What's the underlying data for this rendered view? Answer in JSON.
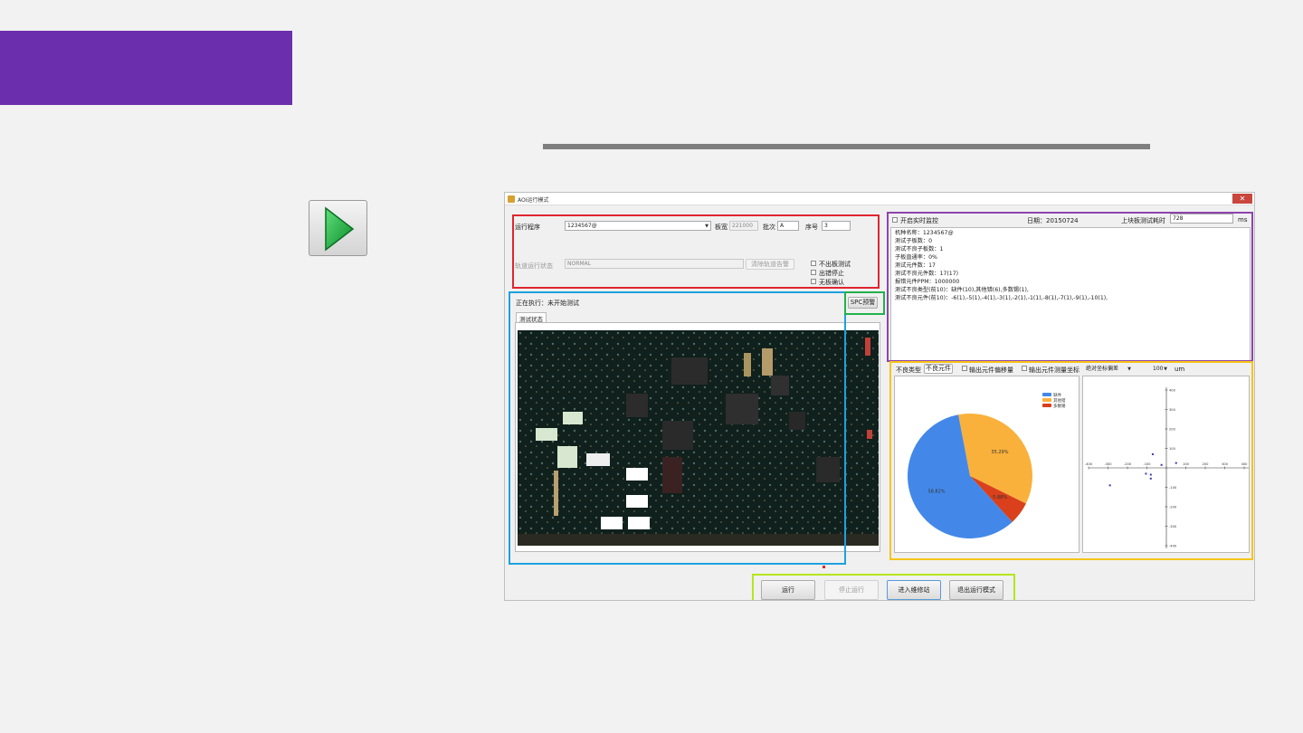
{
  "window": {
    "title": "AOI运行模式",
    "close": "✕"
  },
  "program": {
    "label": "运行程序",
    "value": "1234567@",
    "board_width_label": "板宽",
    "board_width": "221000",
    "batch_label": "批次",
    "batch": "A",
    "seq_label": "序号",
    "seq": "3"
  },
  "track": {
    "label": "轨道运行状态",
    "value": "NORMAL",
    "clear_btn": "清除轨道告警"
  },
  "options": [
    "不出板测试",
    "出错停止",
    "无板确认"
  ],
  "exec": {
    "label": "正在执行：未开始测试",
    "spc_btn": "SPC预警",
    "tab": "测试状态"
  },
  "monitor": {
    "checkbox": "开启实时监控",
    "date": "日期：20150724",
    "time_label": "上块板测试耗时",
    "time_value": "728",
    "unit": "ms"
  },
  "log": [
    "机种名称：1234567@",
    "测试子板数：0",
    "测试不良子板数：1",
    "子板直通率：0%",
    "测试元件数：17",
    "测试不良元件数：17(17)",
    "报错元件PPM：1000000",
    "测试不良类型(前10)：缺件(10),其他错(6),多数锡(1),",
    "测试不良元件(前10)：-6(1),-5(1),-4(1),-3(1),-2(1),-1(1),-8(1),-7(1),-9(1),-10(1),"
  ],
  "stats_bar": {
    "type_label": "不良类型",
    "type_btn": "不良元件",
    "opt1": "输出元件偏移量",
    "opt2": "输出元件测量坐标",
    "coord": "绝对坐标偏差",
    "scale": "100",
    "unit": "um"
  },
  "chart_data": [
    {
      "type": "pie",
      "series": [
        {
          "name": "缺件",
          "value": 58.82,
          "label": "58.82%",
          "color": "#4388e8"
        },
        {
          "name": "其他错",
          "value": 35.29,
          "label": "35.29%",
          "color": "#f9b13c"
        },
        {
          "name": "多数锡",
          "value": 5.88,
          "label": "5.88%",
          "color": "#d9401b"
        }
      ]
    },
    {
      "type": "scatter",
      "xlim": [
        -400,
        400
      ],
      "ylim": [
        -400,
        400
      ],
      "x_ticks": [
        "-400",
        "-300",
        "-200",
        "-100",
        "0",
        "100",
        "200",
        "300",
        "400"
      ],
      "y_ticks": [
        "400",
        "300",
        "200",
        "100",
        "-100",
        "-200",
        "-300",
        "-400"
      ],
      "points": [
        [
          -70,
          70
        ],
        [
          -105,
          -30
        ],
        [
          -80,
          -35
        ],
        [
          -80,
          -55
        ],
        [
          50,
          25
        ],
        [
          -290,
          -90
        ],
        [
          -25,
          15
        ]
      ]
    }
  ],
  "actions": {
    "run": "运行",
    "stop": "停止运行",
    "repair": "进入维修站",
    "exit": "退出运行模式"
  }
}
